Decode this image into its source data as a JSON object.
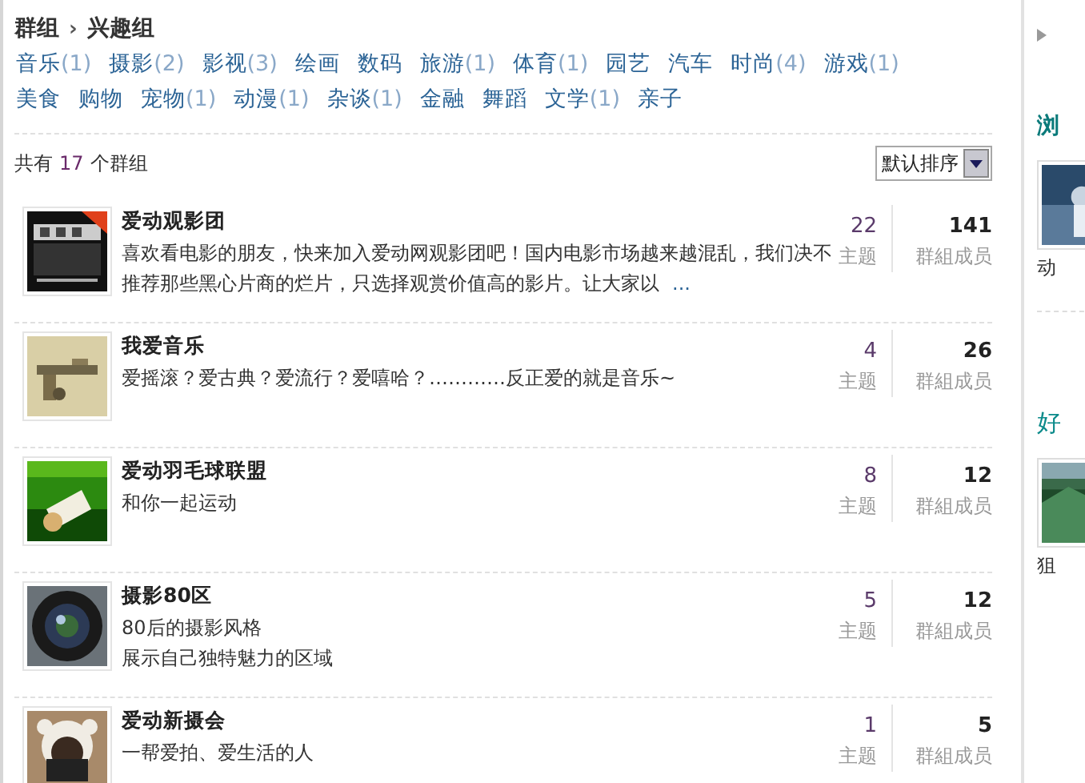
{
  "breadcrumb": {
    "root": "群组",
    "separator": "›",
    "current": "兴趣组"
  },
  "categories": [
    {
      "name": "音乐",
      "count": "(1)"
    },
    {
      "name": "摄影",
      "count": "(2)"
    },
    {
      "name": "影视",
      "count": "(3)"
    },
    {
      "name": "绘画"
    },
    {
      "name": "数码"
    },
    {
      "name": "旅游",
      "count": "(1)"
    },
    {
      "name": "体育",
      "count": "(1)"
    },
    {
      "name": "园艺"
    },
    {
      "name": "汽车"
    },
    {
      "name": "时尚",
      "count": "(4)"
    },
    {
      "name": "游戏",
      "count": "(1)"
    },
    {
      "name": "美食"
    },
    {
      "name": "购物"
    },
    {
      "name": "宠物",
      "count": "(1)"
    },
    {
      "name": "动漫",
      "count": "(1)"
    },
    {
      "name": "杂谈",
      "count": "(1)"
    },
    {
      "name": "金融"
    },
    {
      "name": "舞蹈"
    },
    {
      "name": "文学",
      "count": "(1)"
    },
    {
      "name": "亲子"
    }
  ],
  "summary": {
    "prefix": "共有",
    "count": "17",
    "suffix": "个群组"
  },
  "sort": {
    "value": "默认排序"
  },
  "groups": [
    {
      "name": "爱动观影团",
      "description": "喜欢看电影的朋友，快来加入爱动网观影团吧！国内电影市场越来越混乱，我们决不推荐那些黑心片商的烂片，只选择观赏价值高的影片。让大家以",
      "more": "...",
      "topics": "22",
      "topics_label": "主题",
      "members": "141",
      "members_label": "群組成员"
    },
    {
      "name": "我爱音乐",
      "description": "爱摇滚？爱古典？爱流行？爱嘻哈？…………反正爱的就是音乐~",
      "topics": "4",
      "topics_label": "主题",
      "members": "26",
      "members_label": "群組成员"
    },
    {
      "name": "爱动羽毛球联盟",
      "description": "和你一起运动",
      "topics": "8",
      "topics_label": "主题",
      "members": "12",
      "members_label": "群組成员"
    },
    {
      "name": "摄影80区",
      "description": [
        "80后的摄影风格",
        "展示自己独特魅力的区域"
      ],
      "topics": "5",
      "topics_label": "主题",
      "members": "12",
      "members_label": "群組成员"
    },
    {
      "name": "爱动新摄会",
      "description": "一帮爱拍、爱生活的人",
      "topics": "1",
      "topics_label": "主题",
      "members": "5",
      "members_label": "群組成员"
    }
  ],
  "sidebar": {
    "sections": [
      {
        "title": "浏",
        "caption": "动"
      },
      {
        "title": "好",
        "caption": "狙"
      }
    ]
  }
}
